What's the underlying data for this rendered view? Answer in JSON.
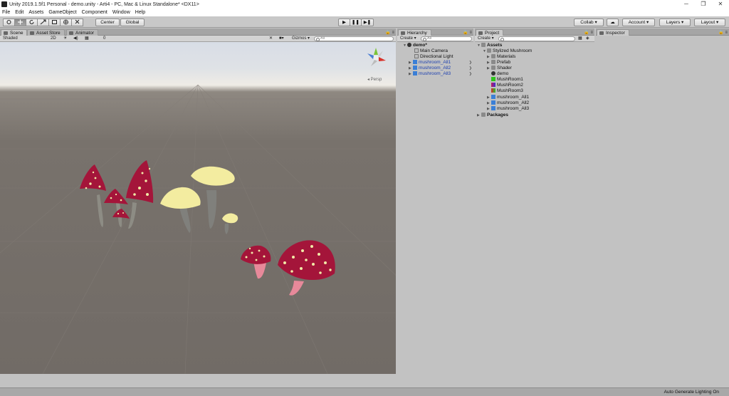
{
  "window": {
    "title": "Unity 2019.1.5f1 Personal - demo.unity - Arti4 - PC, Mac & Linux Standalone* <DX11>",
    "minimize": "─",
    "restore": "❐",
    "close": "✕"
  },
  "menu": [
    "File",
    "Edit",
    "Assets",
    "GameObject",
    "Component",
    "Window",
    "Help"
  ],
  "toolbar": {
    "tools": [
      "hand-icon",
      "move-icon",
      "rotate-icon",
      "scale-icon",
      "rect-icon",
      "transform-icon",
      "custom-tool-icon"
    ],
    "pivot": "Center",
    "space": "Global",
    "play": "▶",
    "pause": "❚❚",
    "step": "▶❚",
    "collab": "Collab ▾",
    "cloud": "☁",
    "account": "Account ▾",
    "layers": "Layers ▾",
    "layout": "Layout ▾"
  },
  "scene_panel": {
    "tabs": [
      "Scene",
      "Asset Store",
      "Animator"
    ],
    "shading": "Shaded",
    "mode2d": "2D",
    "light": "☀",
    "audio": "◀)",
    "fx": "▦",
    "hidden": "0",
    "camera": "■▾",
    "gizmos": "Gizmos ▾",
    "search": "All",
    "persp": "◂ Persp"
  },
  "hierarchy": {
    "tab": "Hierarchy",
    "create": "Create ▾",
    "search": "All",
    "scene_name": "demo*",
    "items": [
      {
        "label": "Main Camera",
        "blue": false
      },
      {
        "label": "Directional Light",
        "blue": false
      },
      {
        "label": "mushroom_All1",
        "blue": true
      },
      {
        "label": "mushroom_All2",
        "blue": true
      },
      {
        "label": "mushroom_All3",
        "blue": true
      }
    ]
  },
  "project": {
    "tab": "Project",
    "create": "Create ▾",
    "root": "Assets",
    "folder": "Stylized Mushroom",
    "items": [
      {
        "label": "Materials",
        "icon": "folder",
        "arrow": "▶"
      },
      {
        "label": "Prefab",
        "icon": "folder",
        "arrow": "▶"
      },
      {
        "label": "Shader",
        "icon": "folder",
        "arrow": "▶"
      },
      {
        "label": "demo",
        "icon": "scene",
        "arrow": ""
      },
      {
        "label": "MushRoom1",
        "icon": "mat1",
        "arrow": ""
      },
      {
        "label": "MushRoom2",
        "icon": "mat2",
        "arrow": ""
      },
      {
        "label": "MushRoom3",
        "icon": "mat3",
        "arrow": ""
      },
      {
        "label": "mushroom_All1",
        "icon": "cube",
        "arrow": "▶"
      },
      {
        "label": "mushroom_All2",
        "icon": "cube",
        "arrow": "▶"
      },
      {
        "label": "mushroom_All3",
        "icon": "cube",
        "arrow": "▶"
      }
    ],
    "packages": "Packages"
  },
  "inspector": {
    "tab": "Inspector"
  },
  "status": "Auto Generate Lighting On",
  "colors": {
    "cap_red": "#a4153a",
    "cap_cream": "#f3eca0",
    "stem_gray": "#8c8c86",
    "stem_pink": "#e7899a",
    "spot": "#f1eaa7"
  }
}
